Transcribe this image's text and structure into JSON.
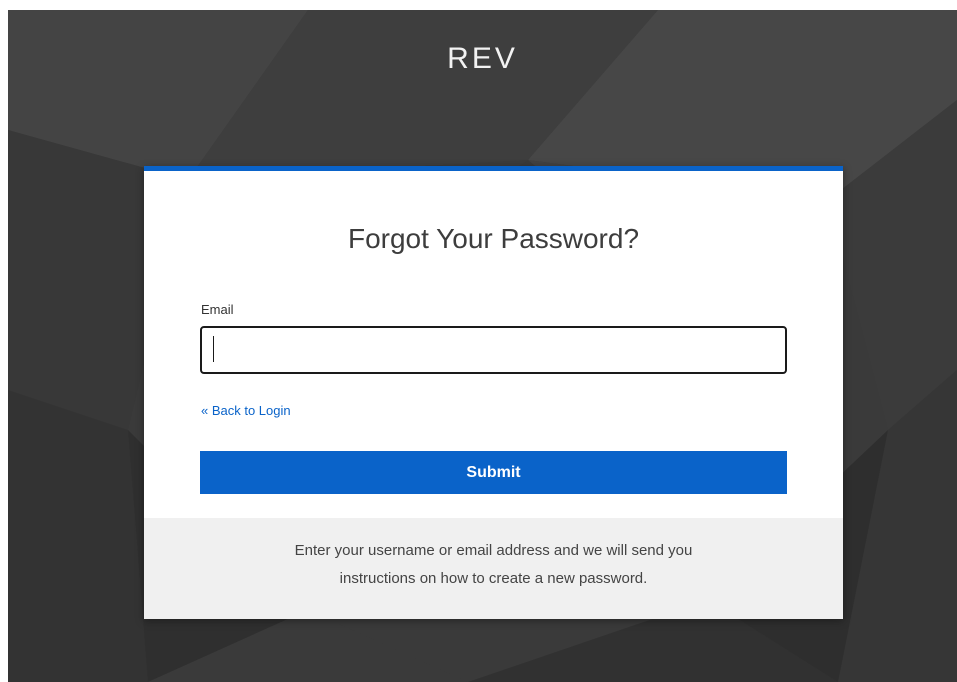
{
  "brand": {
    "logo_text": "REV"
  },
  "form": {
    "title": "Forgot Your Password?",
    "email_label": "Email",
    "email_value": "",
    "back_link": "« Back to Login",
    "submit_label": "Submit"
  },
  "footer": {
    "line1": "Enter your username or email address and we will send you",
    "line2": "instructions on how to create a new password."
  },
  "colors": {
    "accent": "#0a63c9",
    "background": "#3a3a3a",
    "card": "#ffffff",
    "footer_bg": "#f0f0f0"
  }
}
